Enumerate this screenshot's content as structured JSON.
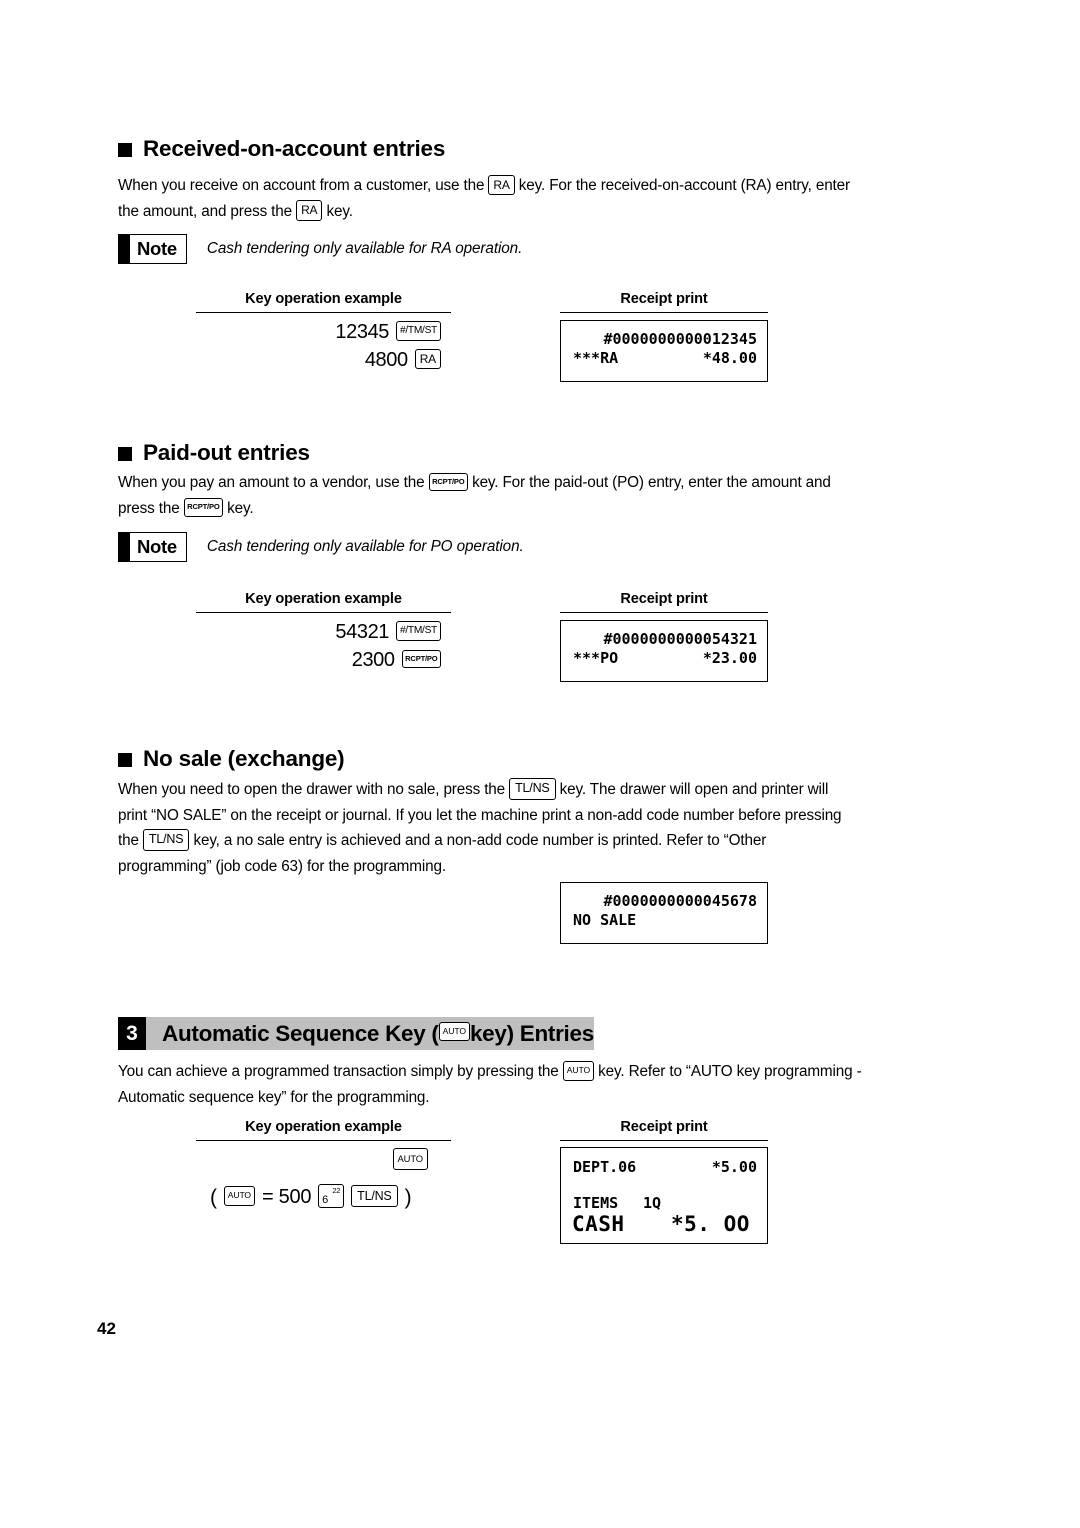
{
  "page": {
    "number": "42"
  },
  "labels": {
    "key_operation_example": "Key operation example",
    "receipt_print": "Receipt print",
    "note": "Note"
  },
  "keys": {
    "ra": "RA",
    "rcptpo": "RCPT/PO",
    "tlns": "TL/NS",
    "tmst": "#/TM/ST",
    "auto": "AUTO",
    "dept_lo": "6",
    "dept_hi": "22"
  },
  "sections": [
    {
      "id": "received-on-account",
      "heading": "Received-on-account entries",
      "paragraph_1": "When you receive on account from a customer, use the ",
      "paragraph_2": " key.  For the received-on-account (RA) entry, enter",
      "paragraph_3": "the amount, and press the ",
      "paragraph_4": " key.",
      "note": "Cash tendering only available for RA operation.",
      "keyops": [
        {
          "amount": "12345",
          "key": "#/TM/ST"
        },
        {
          "amount": "4800",
          "key": "RA"
        }
      ],
      "receipt": {
        "code": "#0000000000012345",
        "label": "***RA",
        "amount": "*48.00"
      }
    },
    {
      "id": "paid-out",
      "heading": "Paid-out entries",
      "paragraph_1": "When you pay an amount to a vendor, use the ",
      "paragraph_2": " key.  For the paid-out (PO) entry, enter the amount and",
      "paragraph_3": "press the ",
      "paragraph_4": " key.",
      "note": "Cash tendering only available for PO operation.",
      "keyops": [
        {
          "amount": "54321",
          "key": "#/TM/ST"
        },
        {
          "amount": "2300",
          "key": "RCPT/PO"
        }
      ],
      "receipt": {
        "code": "#0000000000054321",
        "label": "***PO",
        "amount": "*23.00"
      }
    },
    {
      "id": "no-sale",
      "heading": "No sale (exchange)",
      "line_1a": "When you need to open the drawer with no sale, press the ",
      "line_1b": " key.  The drawer will open and printer will",
      "line_2": "print “NO SALE” on the receipt or journal.  If you let the machine print a non-add code number before pressing",
      "line_3a": "the ",
      "line_3b": " key, a no sale entry is achieved and a non-add code number is printed.  Refer to “Other",
      "line_4": "programming” (job code 63) for the programming.",
      "receipt": {
        "code": "#0000000000045678",
        "label": "NO SALE"
      }
    }
  ],
  "auto_section": {
    "number": "3",
    "title_before": "Automatic Sequence Key (",
    "title_after": " key) Entries",
    "paragraph_1": "You can achieve a programmed transaction simply by pressing the ",
    "paragraph_2": " key.  Refer to “AUTO key programming -",
    "paragraph_3": "Automatic sequence key” for the programming.",
    "keyop_single": "AUTO",
    "definition": {
      "open_paren": "(",
      "equals": "= 500",
      "close_paren": ")"
    },
    "receipt": {
      "dept_label": "DEPT.06",
      "dept_amount": "*5.00",
      "items_label": "ITEMS",
      "items_count": "1Q",
      "cash_label": "CASH",
      "cash_amount": "*5. OO"
    }
  }
}
